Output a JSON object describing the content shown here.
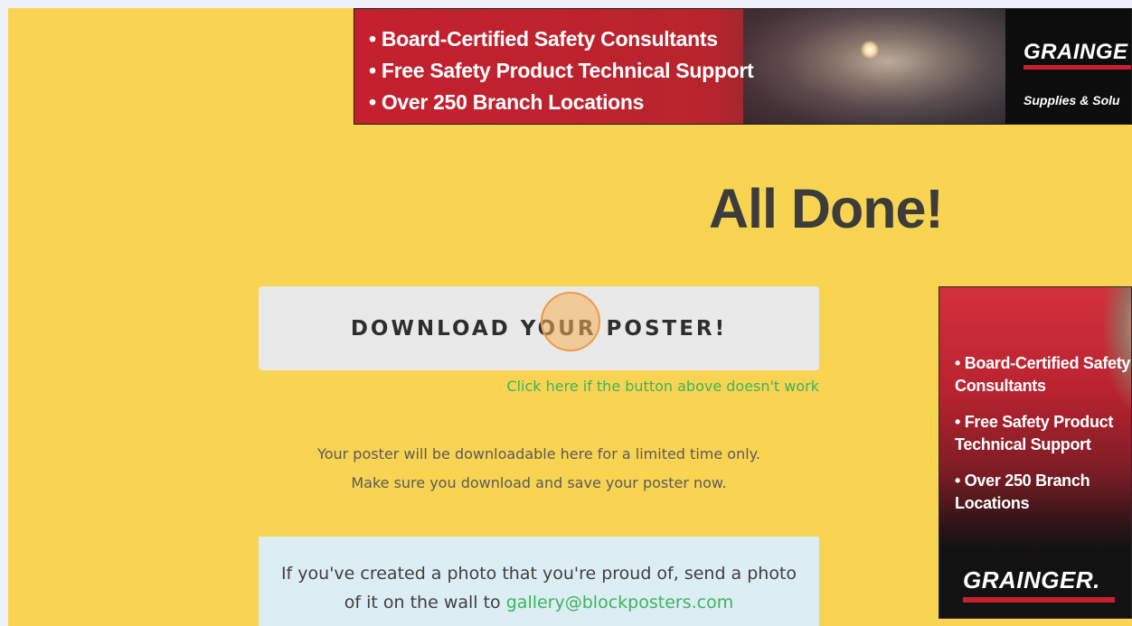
{
  "top_ad": {
    "bullets": [
      "• Board-Certified Safety Consultants",
      "• Free Safety Product Technical Support",
      "• Over 250 Branch Locations"
    ],
    "brand": "GRAINGE",
    "tagline": "Supplies & Solu"
  },
  "main": {
    "title": "All Done!",
    "download_label": "DOWNLOAD YOUR POSTER!",
    "fallback_link": "Click here if the button above doesn't work",
    "notice_line1": "Your poster will be downloadable here for a limited time only.",
    "notice_line2": "Make sure you download and save your poster now.",
    "gallery_line1": "If you've created a photo that you're proud of, send a photo",
    "gallery_line2_prefix": "of it on the wall to ",
    "gallery_email": "gallery@blockposters.com"
  },
  "side_ad": {
    "bullets": [
      "• Board-Certified Safety Consultants",
      "• Free Safety Product Technical Support",
      "• Over 250 Branch Locations"
    ],
    "brand": "GRAINGER."
  },
  "colors": {
    "page_background": "#f9d452",
    "link_green": "#3db35f",
    "ad_red": "#c4202e"
  }
}
